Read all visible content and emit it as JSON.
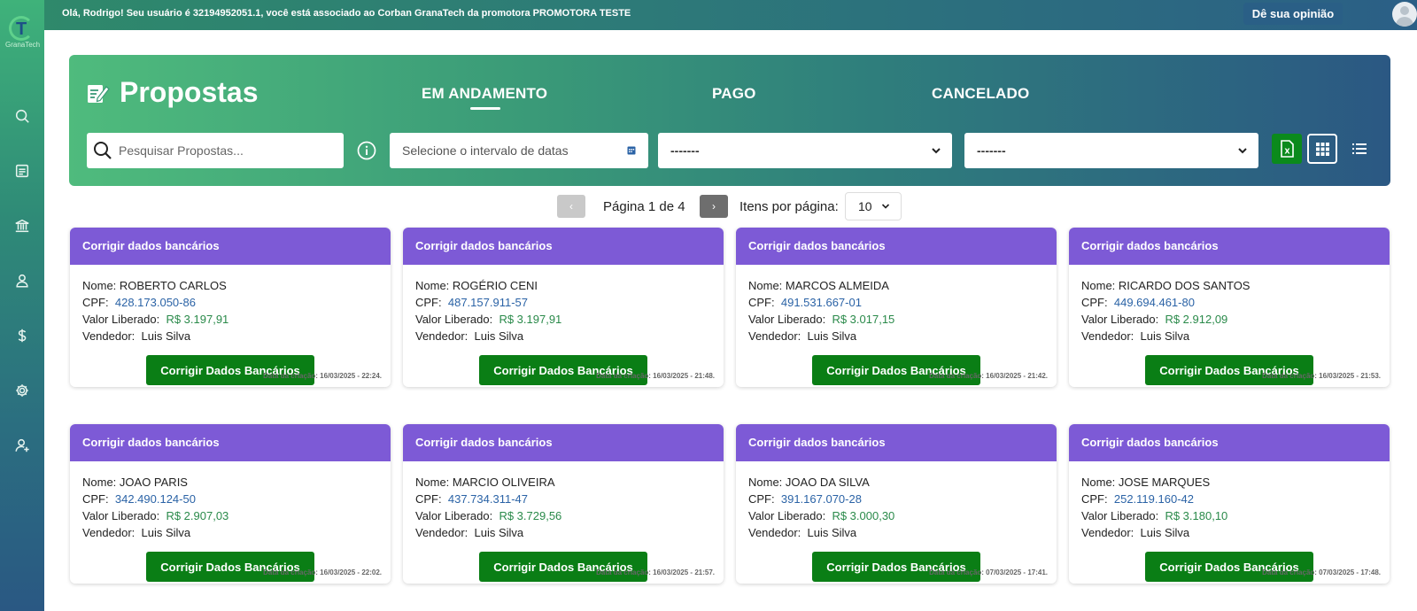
{
  "topbar": {
    "greeting": "Olá, Rodrigo! Seu usuário é 32194952051.1, você está associado ao Corban GranaTech da promotora PROMOTORA TESTE",
    "opinion_label": "Dê sua opinião"
  },
  "sidebar": {
    "logo_text": "GranaTech",
    "items": [
      {
        "icon": "search-icon"
      },
      {
        "icon": "document-icon"
      },
      {
        "icon": "bank-icon"
      },
      {
        "icon": "user-icon"
      },
      {
        "icon": "dollar-icon"
      },
      {
        "icon": "gear-icon"
      },
      {
        "icon": "user-add-icon"
      }
    ]
  },
  "header": {
    "title": "Propostas",
    "tabs": [
      {
        "label": "EM ANDAMENTO",
        "active": true
      },
      {
        "label": "PAGO",
        "active": false
      },
      {
        "label": "CANCELADO",
        "active": false
      }
    ],
    "search_placeholder": "Pesquisar Propostas...",
    "date_placeholder": "Selecione o intervalo de datas",
    "select1_value": "-------",
    "select2_value": "-------"
  },
  "pagination": {
    "prev": "‹",
    "page_label": "Página 1 de 4",
    "next": "›",
    "per_page_label": "Itens por página:",
    "per_page_value": "10"
  },
  "labels": {
    "nome": "Nome:",
    "cpf": "CPF:",
    "valor": "Valor Liberado:",
    "vendedor": "Vendedor:"
  },
  "cards": [
    {
      "header": "Corrigir dados bancários",
      "nome": "ROBERTO CARLOS",
      "cpf": "428.173.050-86",
      "valor": "R$ 3.197,91",
      "vendedor": "Luis Silva",
      "button": "Corrigir Dados Bancários",
      "date": "Data da criação: 16/03/2025 - 22:24."
    },
    {
      "header": "Corrigir dados bancários",
      "nome": "ROGÉRIO CENI",
      "cpf": "487.157.911-57",
      "valor": "R$ 3.197,91",
      "vendedor": "Luis Silva",
      "button": "Corrigir Dados Bancários",
      "date": "Data da criação: 16/03/2025 - 21:48."
    },
    {
      "header": "Corrigir dados bancários",
      "nome": "MARCOS ALMEIDA",
      "cpf": "491.531.667-01",
      "valor": "R$ 3.017,15",
      "vendedor": "Luis Silva",
      "button": "Corrigir Dados Bancários",
      "date": "Data da criação: 16/03/2025 - 21:42."
    },
    {
      "header": "Corrigir dados bancários",
      "nome": "RICARDO DOS SANTOS",
      "cpf": "449.694.461-80",
      "valor": "R$ 2.912,09",
      "vendedor": "Luis Silva",
      "button": "Corrigir Dados Bancários",
      "date": "Data da criação: 16/03/2025 - 21:53."
    },
    {
      "header": "Corrigir dados bancários",
      "nome": "JOAO PARIS",
      "cpf": "342.490.124-50",
      "valor": "R$ 2.907,03",
      "vendedor": "Luis Silva",
      "button": "Corrigir Dados Bancários",
      "date": "Data da criação: 16/03/2025 - 22:02."
    },
    {
      "header": "Corrigir dados bancários",
      "nome": "MARCIO OLIVEIRA",
      "cpf": "437.734.311-47",
      "valor": "R$ 3.729,56",
      "vendedor": "Luis Silva",
      "button": "Corrigir Dados Bancários",
      "date": "Data da criação: 16/03/2025 - 21:57."
    },
    {
      "header": "Corrigir dados bancários",
      "nome": "JOAO DA SILVA",
      "cpf": "391.167.070-28",
      "valor": "R$ 3.000,30",
      "vendedor": "Luis Silva",
      "button": "Corrigir Dados Bancários",
      "date": "Data da criação: 07/03/2025 - 17:41."
    },
    {
      "header": "Corrigir dados bancários",
      "nome": "JOSE MARQUES",
      "cpf": "252.119.160-42",
      "valor": "R$ 3.180,10",
      "vendedor": "Luis Silva",
      "button": "Corrigir Dados Bancários",
      "date": "Data da criação: 07/03/2025 - 17:48."
    }
  ]
}
